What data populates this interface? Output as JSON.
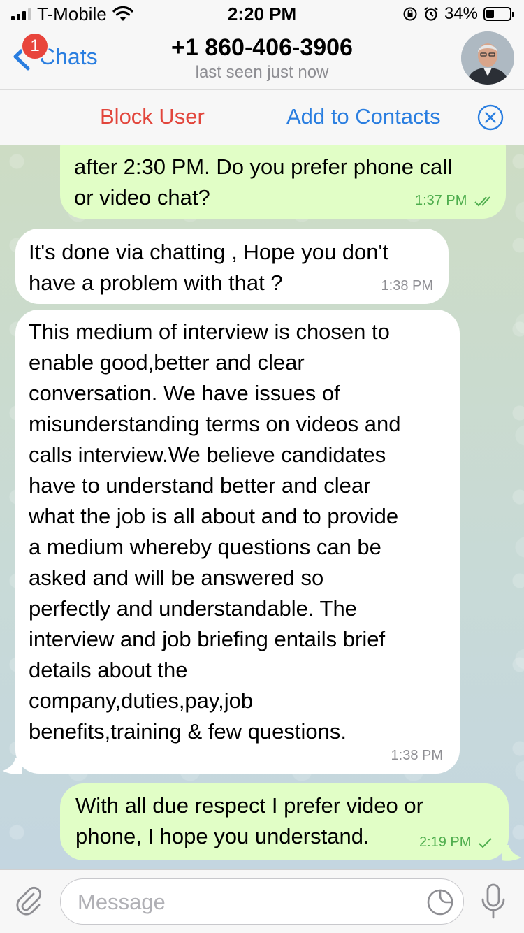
{
  "status_bar": {
    "carrier": "T-Mobile",
    "time": "2:20 PM",
    "battery": "34%"
  },
  "nav": {
    "back_label": "Chats",
    "unread_badge": "1",
    "title": "+1 860-406-3906",
    "subtitle": "last seen just now"
  },
  "actions": {
    "block": "Block User",
    "add": "Add to Contacts"
  },
  "messages": [
    {
      "direction": "outgoing",
      "text": "after 2:30 PM. Do you prefer phone call\nor video chat?",
      "time": "1:37 PM",
      "status": "read"
    },
    {
      "direction": "incoming",
      "text": "It's done via chatting , Hope you don't\nhave a problem with that ?",
      "time": "1:38 PM"
    },
    {
      "direction": "incoming",
      "text": "This medium of interview is chosen to\nenable good,better and clear\nconversation. We have issues of\nmisunderstanding terms on videos and\ncalls interview.We believe candidates\nhave to understand better and clear\nwhat the job is all about and to provide\na medium whereby questions can be\nasked and will be answered so\nperfectly and understandable. The\ninterview and job briefing entails brief\ndetails about the\ncompany,duties,pay,job\nbenefits,training & few questions.",
      "time": "1:38 PM"
    },
    {
      "direction": "outgoing",
      "text": "With all due respect I prefer video or\nphone, I hope you understand.",
      "time": "2:19 PM",
      "status": "delivered"
    }
  ],
  "input": {
    "placeholder": "Message"
  },
  "colors": {
    "accent": "#2a7ee0",
    "danger": "#e2463c",
    "outgoing_bubble": "#e1fec6",
    "incoming_bubble": "#ffffff",
    "read_tick": "#4fae4e"
  },
  "icons": [
    "signal-icon",
    "wifi-icon",
    "orientation-lock-icon",
    "alarm-icon",
    "battery-icon",
    "back-chevron-icon",
    "close-circle-icon",
    "double-check-icon",
    "single-check-icon",
    "paperclip-icon",
    "sticker-icon",
    "microphone-icon"
  ]
}
